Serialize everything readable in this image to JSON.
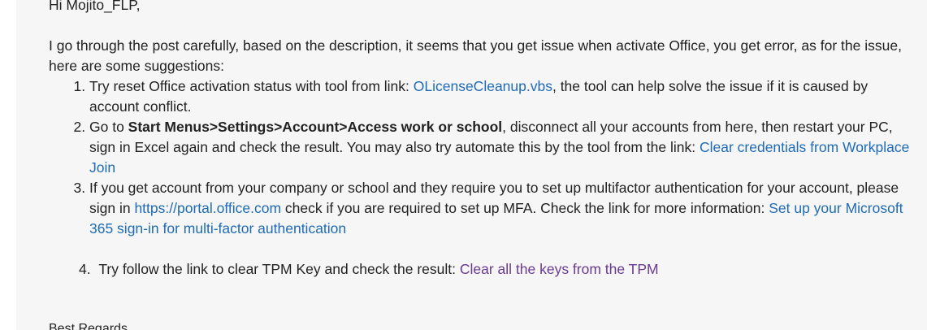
{
  "greeting": "Hi Mojito_FLP,",
  "intro": "I go through the post carefully, based on the description, it seems that you get issue when activate Office, you get error, as for the issue, here are some suggestions:",
  "steps": [
    {
      "number": "1.",
      "before": "Try reset Office activation status with tool from link: ",
      "link": "OLicenseCleanup.vbs",
      "after": ", the tool can help solve the issue if it is caused by account conflict."
    },
    {
      "number": "2.",
      "before": "Go to ",
      "bold": "Start Menus>Settings>Account>Access work or school",
      "middle": ", disconnect all your accounts from here, then restart your PC, sign in Excel again and check the result. You may also try automate this by the tool from the link: ",
      "link": "Clear credentials from Workplace Join"
    },
    {
      "number": "3.",
      "before": "If you get account from your company or school and they require you to set up multifactor authentication for your account,  please sign in ",
      "link1": "https://portal.office.com",
      "middle": " check if you are required to set up MFA. Check the link for more information: ",
      "link2": "Set up your Microsoft 365 sign-in for multi-factor authentication"
    },
    {
      "number": "4.",
      "before": "Try follow the link to clear TPM Key and check the result: ",
      "link": "Clear all the keys from the TPM"
    }
  ],
  "closing": "Best Regards",
  "colors": {
    "link": "#1f6bb5",
    "visited_link": "#6a3a8e",
    "panel_background": "#f6f6f6"
  }
}
